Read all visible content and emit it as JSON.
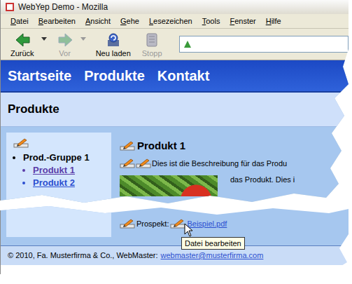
{
  "window": {
    "title": "WebYep Demo - Mozilla"
  },
  "menu": [
    "Datei",
    "Bearbeiten",
    "Ansicht",
    "Gehe",
    "Lesezeichen",
    "Tools",
    "Fenster",
    "Hilfe"
  ],
  "toolbar": [
    {
      "label": "Zurück",
      "disabled": false,
      "dropdown": true,
      "kind": "back"
    },
    {
      "label": "Vor",
      "disabled": true,
      "dropdown": true,
      "kind": "forward"
    },
    {
      "label": "Neu laden",
      "disabled": false,
      "dropdown": false,
      "kind": "reload"
    },
    {
      "label": "Stopp",
      "disabled": true,
      "dropdown": false,
      "kind": "stop"
    }
  ],
  "page": {
    "nav": [
      "Startseite",
      "Produkte",
      "Kontakt"
    ],
    "title": "Produkte",
    "sidebar": {
      "group": "Prod.-Gruppe 1",
      "items": [
        {
          "label": "Produkt 1",
          "selected": true
        },
        {
          "label": "Produkt 2",
          "selected": false
        }
      ]
    },
    "heading": "Produkt 1",
    "description": [
      "Dies ist die Beschreibung für das Produ",
      "das Produkt. Dies i"
    ],
    "attachment": {
      "label": "Prospekt:",
      "file": "Beispiel.pdf"
    },
    "tooltip": "Datei bearbeiten",
    "footer": {
      "text": "© 2010, Fa. Musterfirma & Co., WebMaster:",
      "email": "webmaster@musterfirma.com"
    }
  }
}
